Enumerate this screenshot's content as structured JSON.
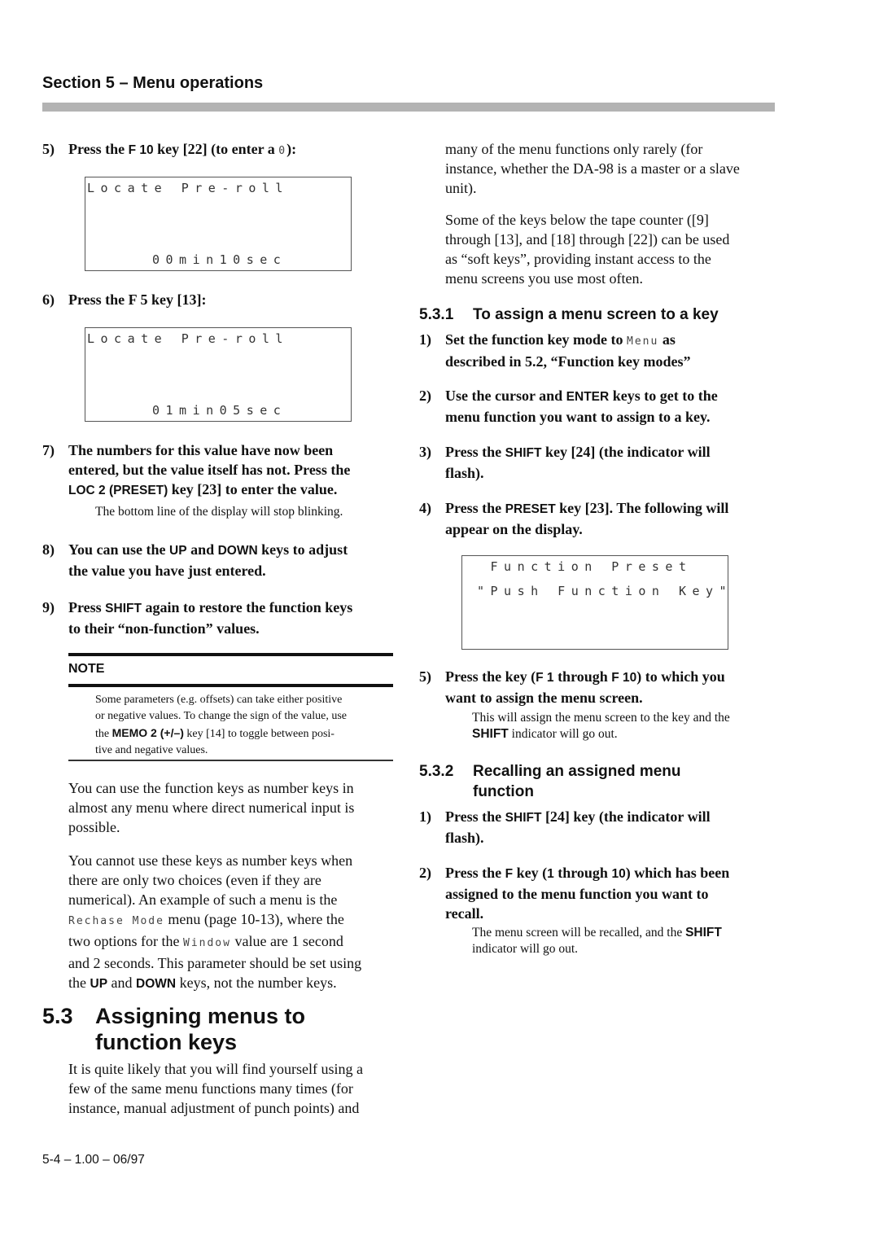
{
  "header": {
    "section_title": "Section 5 – Menu operations"
  },
  "left": {
    "step5": {
      "num": "5)",
      "pre": "Press the ",
      "key": "F 10",
      "mid": " key [22] (to enter a ",
      "lcd_char": "0",
      "post": "):"
    },
    "lcd1": {
      "line1": "Locate Pre-roll",
      "line2": "00min10sec"
    },
    "step6": {
      "num": "6)",
      "text": "Press the F 5 key [13]:"
    },
    "lcd2": {
      "line1": "Locate Pre-roll",
      "line2": "01min05sec"
    },
    "step7": {
      "num": "7)",
      "l1": "The numbers for this value have now been",
      "l2": "entered, but the value itself has not. Press the",
      "key": "LOC 2 (PRESET)",
      "l3": " key [23] to enter the value.",
      "sub": "The bottom line of the display will stop blinking."
    },
    "step8": {
      "num": "8)",
      "pre": "You can use the ",
      "key1": "UP",
      "and": " and ",
      "key2": "DOWN",
      "post": " keys to adjust",
      "l2": "the value you have just entered."
    },
    "step9": {
      "num": "9)",
      "pre": "Press ",
      "key": "SHIFT",
      "post": " again to restore the function keys",
      "l2": "to their “non-function” values."
    },
    "note": {
      "label": "NOTE",
      "l1": "Some parameters (e.g. offsets) can take either positive",
      "l2": "or negative values. To change the sign of the value, use",
      "l3_pre": "the ",
      "l3_key": "MEMO 2 (+/–)",
      "l3_post": " key [14] to toggle between posi-",
      "l4": "tive and negative values."
    },
    "para1": {
      "l1": "You can use the function keys as number keys in",
      "l2": "almost any menu where direct numerical input is",
      "l3": "possible."
    },
    "para2": {
      "l1": "You cannot use these keys as number keys when",
      "l2": "there are only two choices (even if they are",
      "l3": "numerical). An example of such a menu is the",
      "l4_lcd": "Rechase Mode",
      "l4_post": " menu (page 10-13), where the",
      "l5_pre": "two options for the ",
      "l5_lcd": "Window",
      "l5_post": " value are 1 second",
      "l6": "and 2 seconds. This parameter should be set using",
      "l7_pre": "the ",
      "l7_key1": "UP",
      "l7_and": " and ",
      "l7_key2": "DOWN",
      "l7_post": " keys, not the number keys."
    },
    "section53": {
      "num": "5.3",
      "title_l1": "Assigning menus to",
      "title_l2": "function keys"
    },
    "para3": {
      "l1": "It is quite likely that you will find yourself using a",
      "l2": "few of the same menu functions many times (for",
      "l3": "instance, manual adjustment of punch points) and"
    }
  },
  "right": {
    "para1": {
      "l1": "many of the menu functions only rarely (for",
      "l2": "instance, whether the DA-98 is a master or a slave",
      "l3": "unit)."
    },
    "para2": {
      "l1": "Some of the keys below the tape counter ([9]",
      "l2": "through [13], and [18] through [22]) can be used",
      "l3": "as “soft keys”, providing instant access to the",
      "l4": "menu screens you use most often."
    },
    "sub531": {
      "num": "5.3.1",
      "title": "To assign a menu screen to a key"
    },
    "s1": {
      "num": "1)",
      "pre": "Set the function key mode to ",
      "lcd": "Menu",
      "post": " as",
      "l2": "described in 5.2, “Function key modes”"
    },
    "s2": {
      "num": "2)",
      "pre": "Use the cursor and ",
      "key": "ENTER",
      "post": " keys to get to the",
      "l2": "menu function you want to assign to a key."
    },
    "s3": {
      "num": "3)",
      "pre": "Press the ",
      "key": "SHIFT",
      "post": " key [24] (the indicator will",
      "l2": "flash)."
    },
    "s4": {
      "num": "4)",
      "pre": "Press the ",
      "key": "PRESET",
      "post": " key [23]. The following will",
      "l2": "appear on the display."
    },
    "lcd3": {
      "line1": " Function Preset",
      "line2": "\"Push Function Key\""
    },
    "s5": {
      "num": "5)",
      "pre": "Press the key (",
      "key1": "F 1",
      "mid": " through ",
      "key2": "F 10",
      "post": ") to which you",
      "l2": "want to assign the menu screen.",
      "sub_l1": "This will assign the menu screen to the key and the",
      "sub_key": "SHIFT",
      "sub_l2": " indicator will go out."
    },
    "sub532": {
      "num": "5.3.2",
      "title_l1": "Recalling an assigned menu",
      "title_l2": "function"
    },
    "r1": {
      "num": "1)",
      "pre": "Press the ",
      "key": "SHIFT",
      "post": " [24] key (the indicator will",
      "l2": "flash)."
    },
    "r2": {
      "num": "2)",
      "pre": "Press the ",
      "key1": "F",
      "mid1": " key (",
      "key2": "1",
      "mid2": " through ",
      "key3": "10",
      "post": ") which has been",
      "l2": "assigned to the menu function you want to",
      "l3": "recall.",
      "sub_l1": "The menu screen will be recalled, and the ",
      "sub_key": "SHIFT",
      "sub_l2": "indicator will go out."
    }
  },
  "footer": {
    "page": "5-4 – 1.00 – 06/97"
  }
}
